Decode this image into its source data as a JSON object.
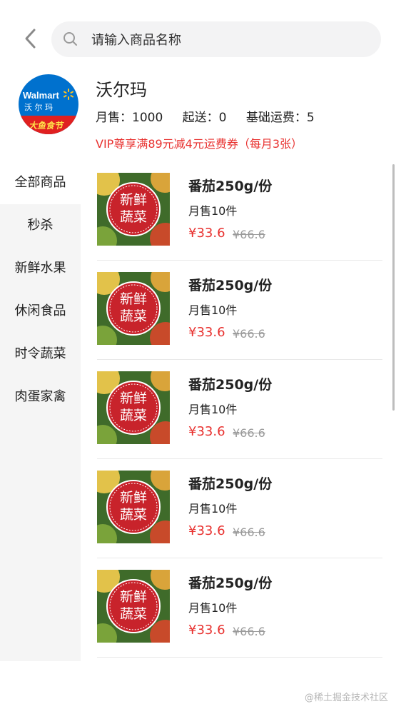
{
  "search": {
    "placeholder": "请输入商品名称"
  },
  "store": {
    "name": "沃尔玛",
    "logo_text": "Walmart",
    "logo_text_cn": "沃尔玛",
    "logo_banner": "大鱼食节",
    "monthly_sales": "月售：1000",
    "min_order": "起送：0",
    "base_delivery": "基础运费：5",
    "promo": "VIP尊享满89元减4元运费券（每月3张）"
  },
  "categories": [
    {
      "label": "全部商品",
      "active": true
    },
    {
      "label": "秒杀"
    },
    {
      "label": "新鲜水果"
    },
    {
      "label": "休闲食品"
    },
    {
      "label": "时令蔬菜"
    },
    {
      "label": "肉蛋家禽"
    }
  ],
  "products": [
    {
      "name": "番茄250g/份",
      "sales": "月售10件",
      "price": "¥33.6",
      "old_price": "¥66.6",
      "badge_line1": "新鲜",
      "badge_line2": "蔬菜"
    },
    {
      "name": "番茄250g/份",
      "sales": "月售10件",
      "price": "¥33.6",
      "old_price": "¥66.6",
      "badge_line1": "新鲜",
      "badge_line2": "蔬菜"
    },
    {
      "name": "番茄250g/份",
      "sales": "月售10件",
      "price": "¥33.6",
      "old_price": "¥66.6",
      "badge_line1": "新鲜",
      "badge_line2": "蔬菜"
    },
    {
      "name": "番茄250g/份",
      "sales": "月售10件",
      "price": "¥33.6",
      "old_price": "¥66.6",
      "badge_line1": "新鲜",
      "badge_line2": "蔬菜"
    },
    {
      "name": "番茄250g/份",
      "sales": "月售10件",
      "price": "¥33.6",
      "old_price": "¥66.6",
      "badge_line1": "新鲜",
      "badge_line2": "蔬菜"
    }
  ],
  "watermark": "@稀土掘金技术社区",
  "colors": {
    "accent": "#e8312f",
    "walmart_blue": "#0071ce",
    "spark_yellow": "#ffc220",
    "badge_red": "#c8232b"
  },
  "icons": {
    "back": "chevron-left-icon",
    "search": "search-icon"
  }
}
